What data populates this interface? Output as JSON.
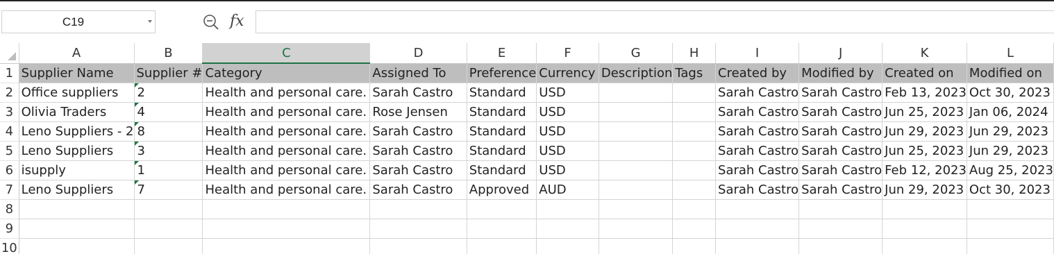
{
  "name_box": {
    "value": "C19"
  },
  "formula_bar": {
    "fx_label": "fx",
    "value": ""
  },
  "icons": {
    "zoom": "zoom-out-icon",
    "name_box_dropdown": "chevron-down-icon"
  },
  "colors": {
    "header_row_bg": "#bebebe",
    "selected_col_header_bg": "#d2d2d2",
    "accent_green": "#1e7145",
    "error_flag_green": "#217346"
  },
  "selected_column": "C",
  "columns": [
    "A",
    "B",
    "C",
    "D",
    "E",
    "F",
    "G",
    "H",
    "I",
    "J",
    "K",
    "L"
  ],
  "row_numbers": [
    "1",
    "2",
    "3",
    "4",
    "5",
    "6",
    "7",
    "8",
    "9",
    "10"
  ],
  "header_row": [
    "Supplier Name",
    "Supplier #",
    "Category",
    "Assigned To",
    "Preference",
    "Currency",
    "Description",
    "Tags",
    "Created by",
    "Modified by",
    "Created on",
    "Modified on"
  ],
  "rows": [
    [
      "Office suppliers",
      "2",
      "Health and personal care.",
      "Sarah Castro",
      "Standard",
      "USD",
      "",
      "",
      "Sarah Castro",
      "Sarah Castro",
      "Feb 13, 2023",
      "Oct 30, 2023"
    ],
    [
      "Olivia Traders",
      "4",
      "Health and personal care.",
      "Rose Jensen",
      "Standard",
      "USD",
      "",
      "",
      "Sarah Castro",
      "Sarah Castro",
      "Jun 25, 2023",
      "Jan 06, 2024"
    ],
    [
      "Leno Suppliers - 2",
      "8",
      "Health and personal care.",
      "Sarah Castro",
      "Standard",
      "USD",
      "",
      "",
      "Sarah Castro",
      "Sarah Castro",
      "Jun 29, 2023",
      "Jun 29, 2023"
    ],
    [
      "Leno Suppliers",
      "3",
      "Health and personal care.",
      "Sarah Castro",
      "Standard",
      "USD",
      "",
      "",
      "Sarah Castro",
      "Sarah Castro",
      "Jun 25, 2023",
      "Jun 29, 2023"
    ],
    [
      "isupply",
      "1",
      "Health and personal care.",
      "Sarah Castro",
      "Standard",
      "USD",
      "",
      "",
      "Sarah Castro",
      "Sarah Castro",
      "Feb 12, 2023",
      "Aug 25, 2023"
    ],
    [
      "Leno Suppliers",
      "7",
      "Health and personal care.",
      "Sarah Castro",
      "Approved",
      "AUD",
      "",
      "",
      "Sarah Castro",
      "Sarah Castro",
      "Jun 29, 2023",
      "Oct 30, 2023"
    ]
  ]
}
